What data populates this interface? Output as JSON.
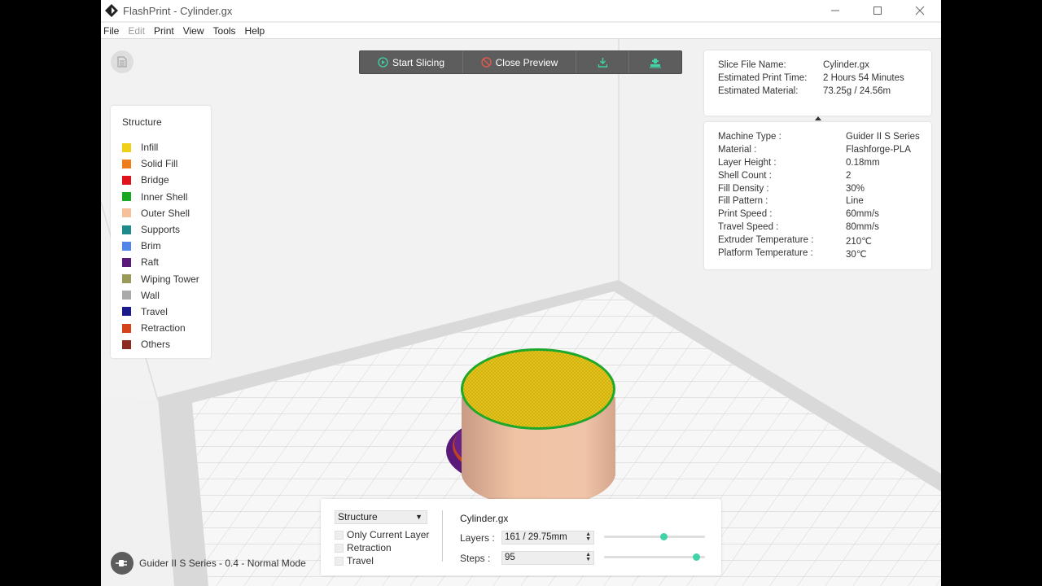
{
  "window": {
    "title": "FlashPrint - Cylinder.gx",
    "controls": [
      "minimize-icon",
      "maximize-icon",
      "close-icon"
    ]
  },
  "menu": [
    "File",
    "Edit",
    "Print",
    "View",
    "Tools",
    "Help"
  ],
  "menu_disabled": [
    "Edit"
  ],
  "toolbar": {
    "start_slicing": "Start Slicing",
    "close_preview": "Close Preview",
    "icons": [
      "play-icon",
      "no-entry-icon",
      "download-icon",
      "print-icon"
    ],
    "accent": "#3fd3a6",
    "close_accent": "#e05a4d"
  },
  "legend": {
    "title": "Structure",
    "items": [
      {
        "label": "Infill",
        "color": "#f2cf17"
      },
      {
        "label": "Solid Fill",
        "color": "#f07d1c"
      },
      {
        "label": "Bridge",
        "color": "#e2121c"
      },
      {
        "label": "Inner Shell",
        "color": "#19a81f"
      },
      {
        "label": "Outer Shell",
        "color": "#f5c09a"
      },
      {
        "label": "Supports",
        "color": "#1e8a8c"
      },
      {
        "label": "Brim",
        "color": "#4f86e8"
      },
      {
        "label": "Raft",
        "color": "#5a1a7a"
      },
      {
        "label": "Wiping Tower",
        "color": "#9a9a58"
      },
      {
        "label": "Wall",
        "color": "#aaaaaa"
      },
      {
        "label": "Travel",
        "color": "#1a1a8c"
      },
      {
        "label": "Retraction",
        "color": "#d4421a"
      },
      {
        "label": "Others",
        "color": "#8c2a22"
      }
    ]
  },
  "slice_info": {
    "rows": [
      {
        "k": "Slice File Name:",
        "v": "Cylinder.gx"
      },
      {
        "k": "Estimated Print Time:",
        "v": "2 Hours 54 Minutes"
      },
      {
        "k": "Estimated Material:",
        "v": "73.25g / 24.56m"
      }
    ]
  },
  "machine_info": {
    "rows": [
      {
        "k": "Machine Type :",
        "v": "Guider II S Series"
      },
      {
        "k": "Material :",
        "v": "Flashforge-PLA"
      },
      {
        "k": "Layer Height :",
        "v": "0.18mm"
      },
      {
        "k": "Shell Count :",
        "v": "2"
      },
      {
        "k": "Fill Density :",
        "v": "30%"
      },
      {
        "k": "Fill Pattern :",
        "v": "Line"
      },
      {
        "k": "Print Speed :",
        "v": "60mm/s"
      },
      {
        "k": "Travel Speed :",
        "v": "80mm/s"
      },
      {
        "k": "Extruder Temperature :",
        "v": "210℃"
      },
      {
        "k": "Platform Temperature :",
        "v": "30℃"
      }
    ]
  },
  "bottom": {
    "mode_select": "Structure",
    "checks": [
      "Only Current Layer",
      "Retraction",
      "Travel"
    ],
    "file": "Cylinder.gx",
    "layers_label": "Layers :",
    "layers_value": "161 / 29.75mm",
    "layers_fraction": 0.6,
    "steps_label": "Steps :",
    "steps_value": "95",
    "steps_fraction": 0.95
  },
  "status": "Guider II S Series - 0.4 - Normal Mode"
}
